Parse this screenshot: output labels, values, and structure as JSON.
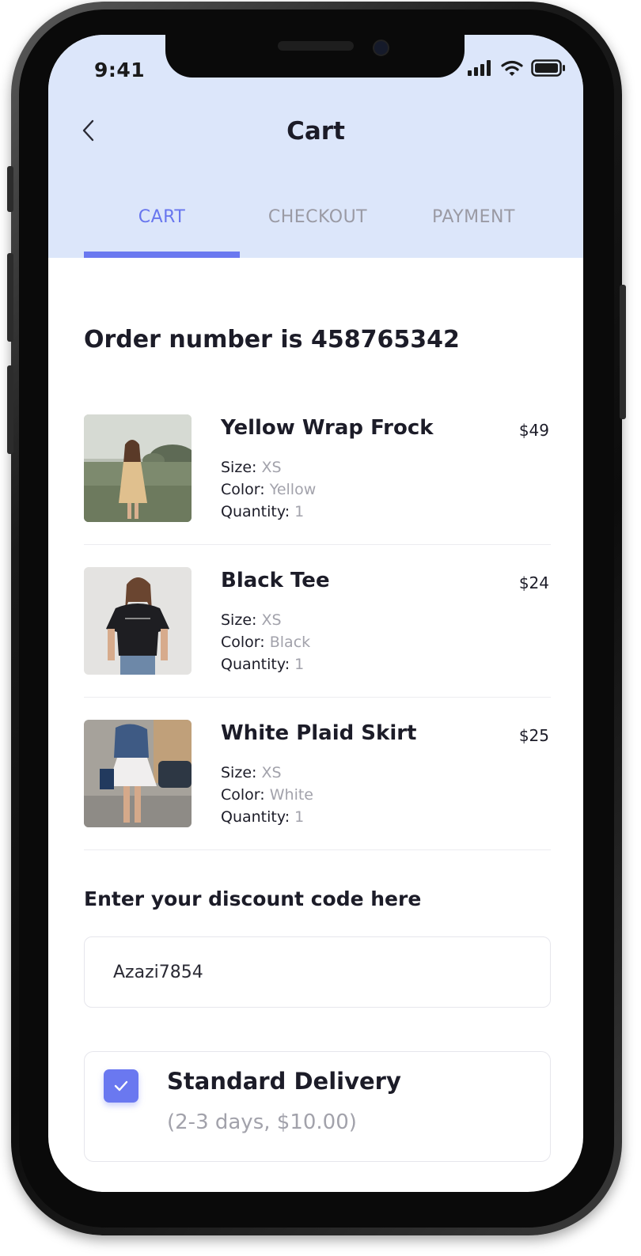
{
  "status_bar": {
    "time": "9:41"
  },
  "header": {
    "title": "Cart"
  },
  "tabs": [
    {
      "label": "CART",
      "active": true
    },
    {
      "label": "CHECKOUT",
      "active": false
    },
    {
      "label": "PAYMENT",
      "active": false
    }
  ],
  "order": {
    "title": "Order number is 458765342"
  },
  "meta_labels": {
    "size": "Size:",
    "color": "Color:",
    "quantity": "Quantity:"
  },
  "items": [
    {
      "name": "Yellow Wrap Frock",
      "price": "$49",
      "size": "XS",
      "color": "Yellow",
      "quantity": "1"
    },
    {
      "name": "Black Tee",
      "price": "$24",
      "size": "XS",
      "color": "Black",
      "quantity": "1"
    },
    {
      "name": "White Plaid Skirt",
      "price": "$25",
      "size": "XS",
      "color": "White",
      "quantity": "1"
    }
  ],
  "discount": {
    "label": "Enter your discount code here",
    "value": "Azazi7854"
  },
  "delivery": {
    "title": "Standard Delivery",
    "subtitle": "(2-3 days, $10.00)",
    "checked": true
  },
  "colors": {
    "accent": "#6a78f0",
    "header_bg": "#dce6fa",
    "text_primary": "#1c1c28",
    "text_muted": "#a2a2ab",
    "tab_inactive": "#9a9aa4"
  },
  "icons": {
    "back": "chevron-left-icon",
    "signal": "signal-icon",
    "wifi": "wifi-icon",
    "battery": "battery-icon",
    "check": "check-icon"
  }
}
